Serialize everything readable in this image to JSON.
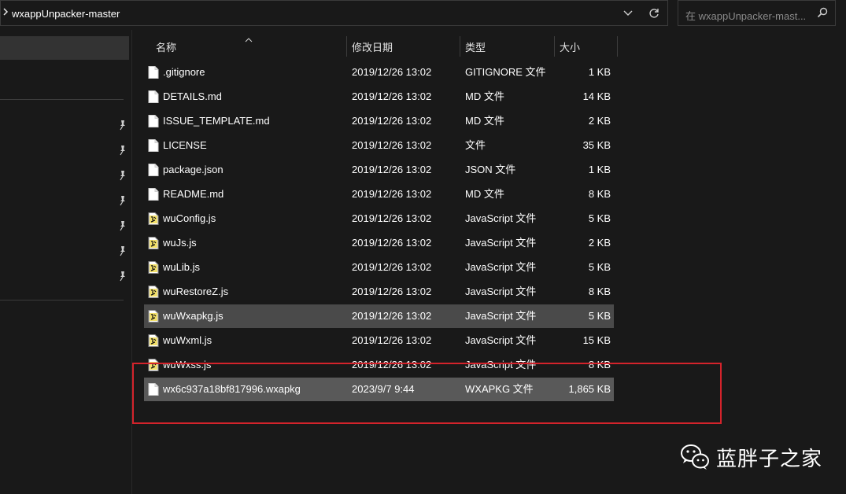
{
  "window": {
    "background": "#191919",
    "text_color": "#ffffff"
  },
  "address_bar": {
    "path": "wxappUnpacker-master",
    "dropdown_icon": "chevron-down-icon",
    "refresh_icon": "refresh-icon"
  },
  "search": {
    "placeholder": "在 wxappUnpacker-mast...",
    "icon": "search-icon"
  },
  "nav_pane": {
    "pinned_items": 7
  },
  "columns": [
    {
      "label": "名称"
    },
    {
      "label": "修改日期"
    },
    {
      "label": "类型"
    },
    {
      "label": "大小"
    }
  ],
  "files": [
    {
      "name": ".gitignore",
      "date": "2019/12/26 13:02",
      "type": "GITIGNORE 文件",
      "size": "1 KB",
      "icon": "file-icon"
    },
    {
      "name": "DETAILS.md",
      "date": "2019/12/26 13:02",
      "type": "MD 文件",
      "size": "14 KB",
      "icon": "file-icon"
    },
    {
      "name": "ISSUE_TEMPLATE.md",
      "date": "2019/12/26 13:02",
      "type": "MD 文件",
      "size": "2 KB",
      "icon": "file-icon"
    },
    {
      "name": "LICENSE",
      "date": "2019/12/26 13:02",
      "type": "文件",
      "size": "35 KB",
      "icon": "file-icon"
    },
    {
      "name": "package.json",
      "date": "2019/12/26 13:02",
      "type": "JSON 文件",
      "size": "1 KB",
      "icon": "file-icon"
    },
    {
      "name": "README.md",
      "date": "2019/12/26 13:02",
      "type": "MD 文件",
      "size": "8 KB",
      "icon": "file-icon"
    },
    {
      "name": "wuConfig.js",
      "date": "2019/12/26 13:02",
      "type": "JavaScript 文件",
      "size": "5 KB",
      "icon": "js-file-icon"
    },
    {
      "name": "wuJs.js",
      "date": "2019/12/26 13:02",
      "type": "JavaScript 文件",
      "size": "2 KB",
      "icon": "js-file-icon"
    },
    {
      "name": "wuLib.js",
      "date": "2019/12/26 13:02",
      "type": "JavaScript 文件",
      "size": "5 KB",
      "icon": "js-file-icon"
    },
    {
      "name": "wuRestoreZ.js",
      "date": "2019/12/26 13:02",
      "type": "JavaScript 文件",
      "size": "8 KB",
      "icon": "js-file-icon"
    },
    {
      "name": "wuWxapkg.js",
      "date": "2019/12/26 13:02",
      "type": "JavaScript 文件",
      "size": "5 KB",
      "icon": "js-file-icon",
      "state": "selected"
    },
    {
      "name": "wuWxml.js",
      "date": "2019/12/26 13:02",
      "type": "JavaScript 文件",
      "size": "15 KB",
      "icon": "js-file-icon"
    },
    {
      "name": "wuWxss.js",
      "date": "2019/12/26 13:02",
      "type": "JavaScript 文件",
      "size": "8 KB",
      "icon": "js-file-icon"
    },
    {
      "name": "wx6c937a18bf817996.wxapkg",
      "date": "2023/9/7 9:44",
      "type": "WXAPKG 文件",
      "size": "1,865 KB",
      "icon": "file-icon",
      "state": "hover"
    }
  ],
  "highlight": {
    "color": "#d4232b",
    "icon": "highlight-box"
  },
  "watermark": {
    "text": "蓝胖子之家",
    "icon": "wechat-logo-icon"
  }
}
